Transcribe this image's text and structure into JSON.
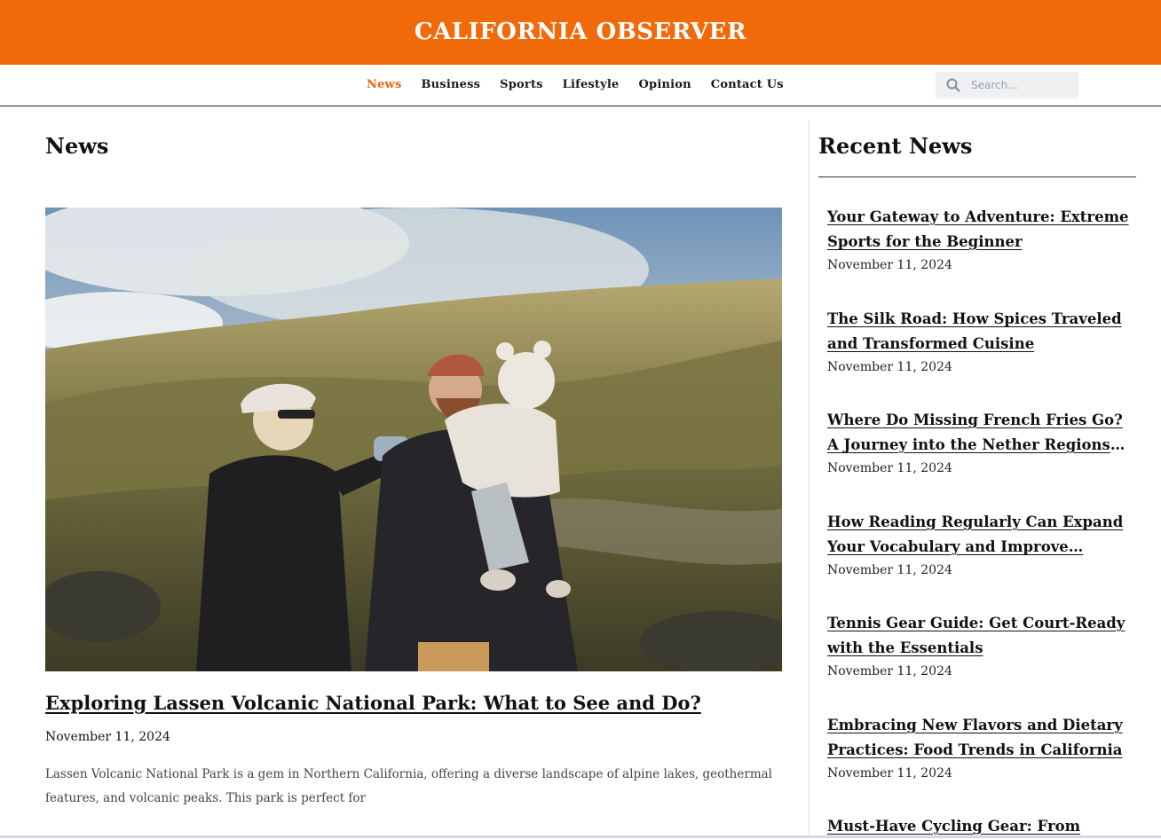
{
  "site": {
    "title": "CALIFORNIA OBSERVER",
    "brand_color": "#f06a0a"
  },
  "nav": {
    "items": [
      {
        "label": "News",
        "active": true
      },
      {
        "label": "Business",
        "active": false
      },
      {
        "label": "Sports",
        "active": false
      },
      {
        "label": "Lifestyle",
        "active": false
      },
      {
        "label": "Opinion",
        "active": false
      },
      {
        "label": "Contact Us",
        "active": false
      }
    ],
    "active_color": "#e6670a",
    "search": {
      "placeholder": "Search...",
      "icon": "search-icon"
    }
  },
  "main": {
    "heading": "News",
    "featured": {
      "image": "photo-family-hiking-mountains",
      "title": "Exploring Lassen Volcanic National Park: What to See and Do?",
      "date": "November 11, 2024",
      "excerpt": "Lassen Volcanic National Park is a gem in Northern California, offering a diverse landscape of alpine lakes, geothermal features, and volcanic peaks. This park is perfect for"
    }
  },
  "sidebar": {
    "heading": "Recent News",
    "items": [
      {
        "title": "Your Gateway to Adventure: Extreme Sports for the Beginner",
        "date": "November 11, 2024"
      },
      {
        "title": "The Silk Road: How Spices Traveled and Transformed Cuisine",
        "date": "November 11, 2024"
      },
      {
        "title": "Where Do Missing French Fries Go? A Journey into the Nether Regions of…",
        "date": "November 11, 2024"
      },
      {
        "title": "How Reading Regularly Can Expand Your Vocabulary and Improve…",
        "date": "November 11, 2024"
      },
      {
        "title": "Tennis Gear Guide: Get Court-Ready with the Essentials",
        "date": "November 11, 2024"
      },
      {
        "title": "Embracing New Flavors and Dietary Practices: Food Trends in California",
        "date": "November 11, 2024"
      },
      {
        "title": "Must-Have Cycling Gear: From",
        "date": ""
      }
    ]
  }
}
